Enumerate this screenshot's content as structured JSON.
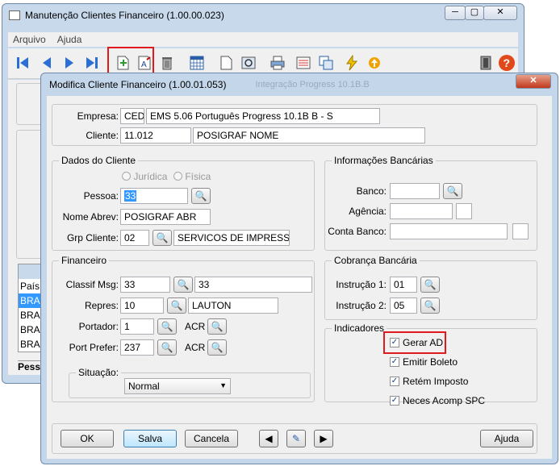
{
  "main": {
    "title": "Manutenção Clientes Financeiro (1.00.00.023)",
    "menu": [
      "Arquivo",
      "Ajuda"
    ],
    "table": {
      "header": "País",
      "rows": [
        "BRA",
        "BRA",
        "BRA",
        "BRA"
      ],
      "footer": "Pess"
    }
  },
  "dialog": {
    "title": "Modifica Cliente Financeiro (1.00.01.053)",
    "ghost_title": "Integração Progress 10.1B.B",
    "empresa": {
      "label": "Empresa:",
      "code": "CED",
      "desc": "EMS 5.06 Português Progress 10.1B B - S"
    },
    "cliente": {
      "label": "Cliente:",
      "code": "11.012",
      "desc": "POSIGRAF NOME"
    },
    "dados": {
      "title": "Dados do Cliente",
      "radio_j": "Jurídica",
      "radio_f": "Física",
      "pessoa_label": "Pessoa:",
      "pessoa_value": "33",
      "abrev_label": "Nome Abrev:",
      "abrev_value": "POSIGRAF ABR",
      "grp_label": "Grp Cliente:",
      "grp_code": "02",
      "grp_desc": "SERVICOS DE IMPRESSA"
    },
    "bancarias": {
      "title": "Informações Bancárias",
      "banco": "Banco:",
      "agencia": "Agência:",
      "conta": "Conta Banco:"
    },
    "financeiro": {
      "title": "Financeiro",
      "classif_label": "Classif Msg:",
      "classif_code": "33",
      "classif_desc": "33",
      "repres_label": "Repres:",
      "repres_code": "10",
      "repres_desc": "LAUTON",
      "portador_label": "Portador:",
      "portador_code": "1",
      "portador_acr": "ACR",
      "portpref_label": "Port Prefer:",
      "portpref_code": "237",
      "portpref_acr": "ACR",
      "situacao_label": "Situação:",
      "situacao_value": "Normal"
    },
    "cobranca": {
      "title": "Cobrança Bancária",
      "instr1_label": "Instrução 1:",
      "instr1": "01",
      "instr2_label": "Instrução 2:",
      "instr2": "05"
    },
    "indicadores": {
      "title": "Indicadores",
      "items": [
        "Gerar AD",
        "Emitir Boleto",
        "Retém Imposto",
        "Neces Acomp SPC"
      ]
    },
    "buttons": {
      "ok": "OK",
      "salva": "Salva",
      "cancela": "Cancela",
      "ajuda": "Ajuda"
    }
  },
  "colors": {
    "highlight_box": "#e0191f",
    "selection": "#3399ff"
  }
}
